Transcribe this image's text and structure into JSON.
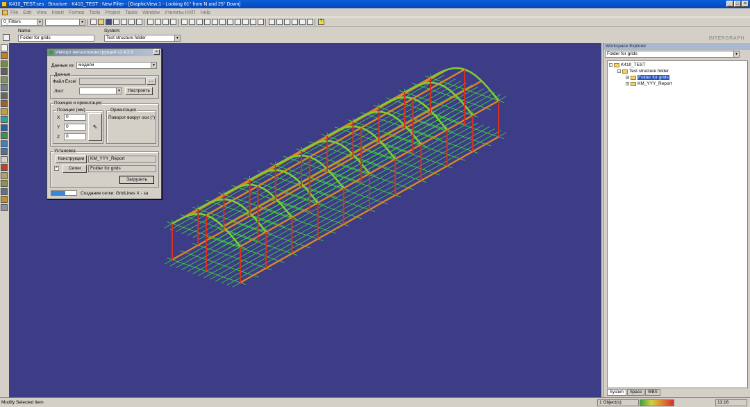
{
  "window": {
    "title": "K410_TEST.ses : Structure : K410_TEST : New Filter - [GraphicView:1 - Looking 61° from N and 25° Down]",
    "minimize": "_",
    "maximize": "□",
    "close": "×"
  },
  "menu": [
    "File",
    "Edit",
    "View",
    "Insert",
    "Format",
    "Tools",
    "Project",
    "Tasks",
    "Window",
    "Утилиты НХП",
    "Help"
  ],
  "toolbar": {
    "filter_value": "0_Filters",
    "brand": "INTERGRAPH"
  },
  "properties_bar": {
    "name_label": "Name:",
    "name_value": "Folder for grids",
    "system_label": "System:",
    "system_value": "Test structure folder"
  },
  "dialog": {
    "title": "Импорт металлоконструкций v1.4.2.0",
    "close": "×",
    "source_label": "Данные из",
    "source_value": "модели",
    "data_group": "Данные",
    "excel_label": "Файл Excel",
    "excel_value": "",
    "browse_label": "...",
    "sheet_label": "Лист",
    "sheet_value": "",
    "configure_button": "Настроить",
    "position_group": "Позиция и ориентация",
    "position_sub": "Позиция (мм)",
    "x_label": "X",
    "x_value": "0",
    "y_label": "Y",
    "y_value": "0",
    "z_label": "Z",
    "z_value": "0",
    "orientation_sub": "Ориентация",
    "rotation_label": "Поворот вокруг оси (°)",
    "install_group": "Установка",
    "structures_button": "Конструкции",
    "structures_value": "KM_YYY_Report",
    "grids_checked": "✓",
    "grids_button": "Сетки",
    "grids_value": "Folder for grids",
    "load_button": "Загрузить",
    "progress_fraction": 0.55,
    "status_text": "Создание сетки: GridLines X - за"
  },
  "explorer": {
    "title": "Workspace Explorer",
    "filter_value": "Folder for grids",
    "tree": {
      "root": "K410_TEST",
      "folder": "Test structure folder",
      "selected": "Folder for grids",
      "report": "KM_YYY_Report"
    },
    "tabs": [
      "System",
      "Space",
      "WBS"
    ]
  },
  "status": {
    "message": "Modify Selected Item",
    "count": "1 Object(s)",
    "time": "13:16"
  },
  "colors": {
    "viewport_bg": "#3d3c86",
    "grid_green": "#3fdc3a",
    "beam_orange": "#d88a20",
    "column_red": "#d83020",
    "selection": "#2050c0"
  }
}
